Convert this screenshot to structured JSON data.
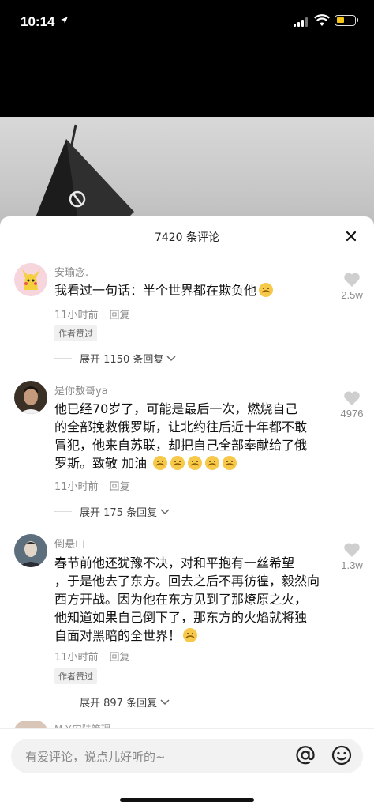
{
  "status": {
    "time": "10:14"
  },
  "sheet": {
    "title": "7420 条评论"
  },
  "comments": [
    {
      "user": "安瑜念.",
      "text": "我看过一句话：半个世界都在欺负他",
      "emoji_count": 1,
      "time": "11小时前",
      "reply_label": "回复",
      "author_liked": "作者赞过",
      "likes": "2.5w",
      "expand": "展开 1150 条回复"
    },
    {
      "user": "是你敖哥ya",
      "text_lines": [
        "他已经70岁了，可能是最后一次，燃烧自己",
        "的全部挽救俄罗斯，让北约往后近十年都不敢",
        "冒犯，他来自苏联，却把自己全部奉献给了俄",
        "罗斯。致敬 加油"
      ],
      "emoji_count": 5,
      "time": "11小时前",
      "reply_label": "回复",
      "likes": "4976",
      "expand": "展开 175 条回复"
    },
    {
      "user": "倒悬山",
      "text_lines": [
        "春节前他还犹豫不决，对和平抱有一丝希望",
        "，于是他去了东方。回去之后不再彷徨，毅然向",
        "西方开战。因为他在东方见到了那燎原之火，",
        "他知道如果自己倒下了，那东方的火焰就将独",
        "自面对黑暗的全世界！"
      ],
      "emoji_count": 1,
      "time": "11小时前",
      "reply_label": "回复",
      "author_liked": "作者赞过",
      "likes": "1.3w",
      "expand": "展开 897 条回复"
    }
  ],
  "partial_comment_user": "M.Y.安陆策理",
  "input": {
    "placeholder": "有爱评论，说点儿好听的~"
  },
  "colors": {
    "emoji": "#f7c94a",
    "sheet_bg": "#ffffff",
    "muted": "#8a8a8a"
  },
  "icons": [
    "location-arrow-icon",
    "signal-icon",
    "wifi-icon",
    "battery-icon",
    "close-icon",
    "heart-icon",
    "chevron-down-icon",
    "at-icon",
    "smile-icon"
  ]
}
